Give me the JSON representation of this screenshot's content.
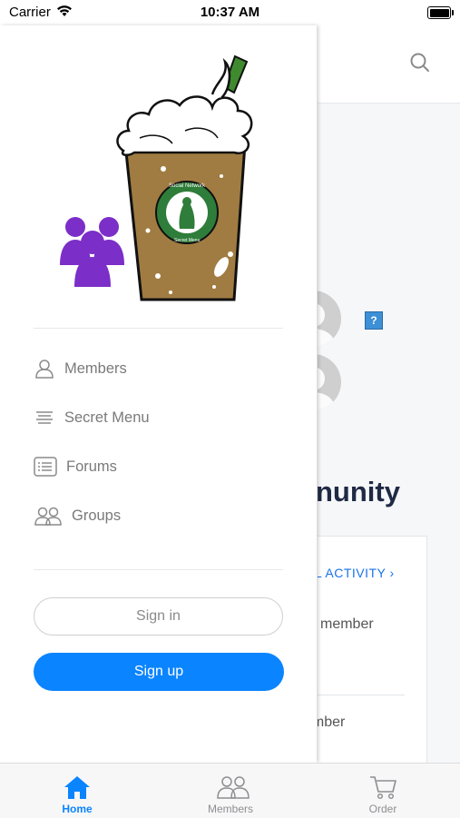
{
  "status_bar": {
    "carrier": "Carrier",
    "time": "10:37 AM",
    "icons": [
      "wifi-icon",
      "battery-icon"
    ]
  },
  "drawer": {
    "logo": {
      "description_icon": "frappuccino-logo-icon",
      "badge_text": "Social Network",
      "badge_subtext": "Secret Menu"
    },
    "menu": [
      {
        "label": "Members",
        "icon": "person-outline-icon"
      },
      {
        "label": "Secret Menu",
        "icon": "lines-icon"
      },
      {
        "label": "Forums",
        "icon": "list-box-icon"
      },
      {
        "label": "Groups",
        "icon": "people-outline-icon"
      }
    ],
    "sign_in_label": "Sign in",
    "sign_up_label": "Sign up"
  },
  "background_page": {
    "community_partial": "nunity",
    "activity_link_partial": "L ACTIVITY ›",
    "member_text_1": "member",
    "member_text_2": "ember",
    "question_badge": "?"
  },
  "tab_bar": {
    "tabs": [
      {
        "label": "Home",
        "icon": "home-icon",
        "active": true
      },
      {
        "label": "Members",
        "icon": "members-icon",
        "active": false
      },
      {
        "label": "Order",
        "icon": "cart-icon",
        "active": false
      }
    ]
  },
  "colors": {
    "accent": "#0a84ff",
    "purple": "#7b2ec8",
    "title": "#1f2a44"
  }
}
